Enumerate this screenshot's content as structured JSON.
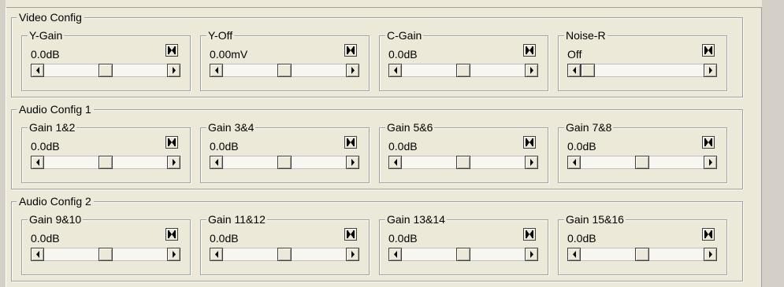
{
  "groups": [
    {
      "title": "Video Config",
      "controls": [
        {
          "title": "Y-Gain",
          "value": "0.0dB",
          "position": 0.5
        },
        {
          "title": "Y-Off",
          "value": "0.00mV",
          "position": 0.5
        },
        {
          "title": "C-Gain",
          "value": "0.0dB",
          "position": 0.5
        },
        {
          "title": "Noise-R",
          "value": "Off",
          "position": 0.0
        }
      ]
    },
    {
      "title": "Audio Config 1",
      "controls": [
        {
          "title": "Gain 1&2",
          "value": "0.0dB",
          "position": 0.5
        },
        {
          "title": "Gain 3&4",
          "value": "0.0dB",
          "position": 0.5
        },
        {
          "title": "Gain 5&6",
          "value": "0.0dB",
          "position": 0.5
        },
        {
          "title": "Gain 7&8",
          "value": "0.0dB",
          "position": 0.5
        }
      ]
    },
    {
      "title": "Audio Config 2",
      "controls": [
        {
          "title": "Gain 9&10",
          "value": "0.0dB",
          "position": 0.5
        },
        {
          "title": "Gain 11&12",
          "value": "0.0dB",
          "position": 0.5
        },
        {
          "title": "Gain 13&14",
          "value": "0.0dB",
          "position": 0.5
        },
        {
          "title": "Gain 15&16",
          "value": "0.0dB",
          "position": 0.5
        }
      ]
    }
  ],
  "icons": {
    "reset": "reset-icon",
    "scroll_left": "scroll-left-arrow-icon",
    "scroll_right": "scroll-right-arrow-icon"
  }
}
